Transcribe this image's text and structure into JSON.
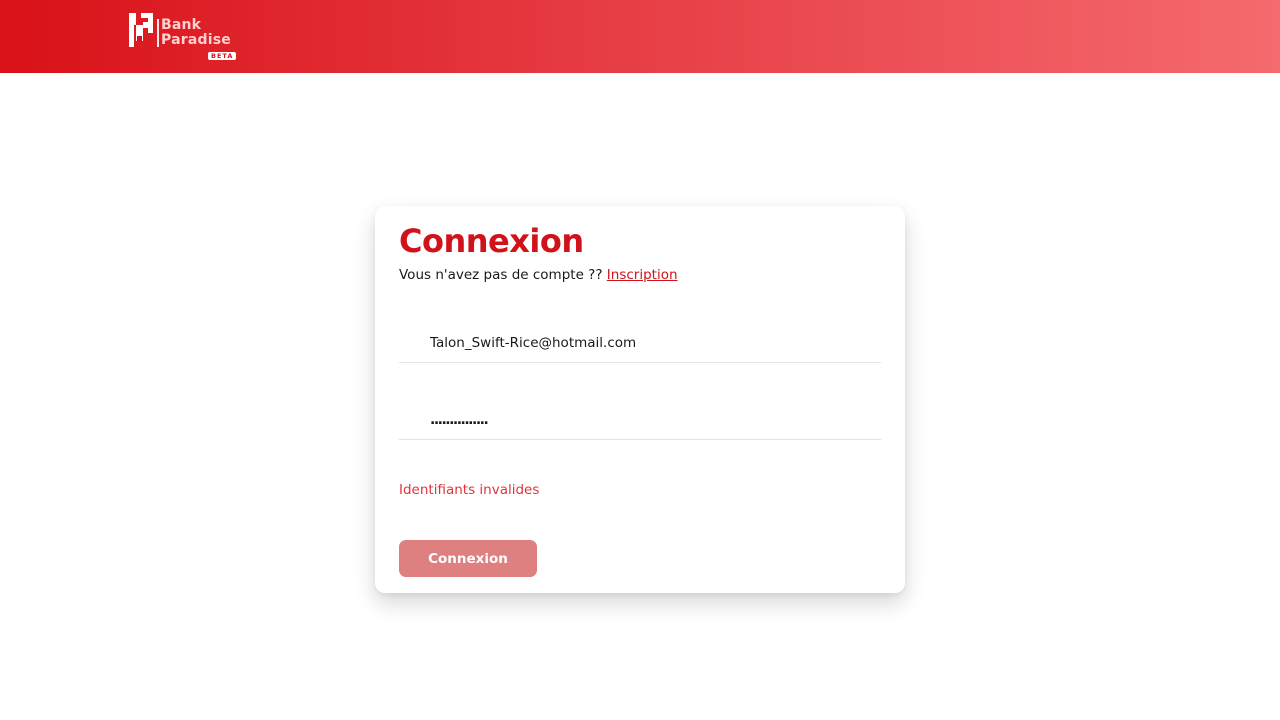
{
  "header": {
    "brand_line1": "Bank",
    "brand_line2": "Paradise",
    "badge": "BETA",
    "gradient_start": "#d91118",
    "gradient_end": "#f46a6e"
  },
  "login": {
    "title": "Connexion",
    "subtitle_text": "Vous n'avez pas de compte ??",
    "signup_link": "Inscription",
    "email_value": "Talon_Swift-Rice@hotmail.com",
    "password_value": "...............",
    "error_message": "Identifiants invalides",
    "submit_label": "Connexion",
    "accent_color": "#d1121a",
    "error_color": "#e0343c",
    "button_color": "#de7f80"
  }
}
